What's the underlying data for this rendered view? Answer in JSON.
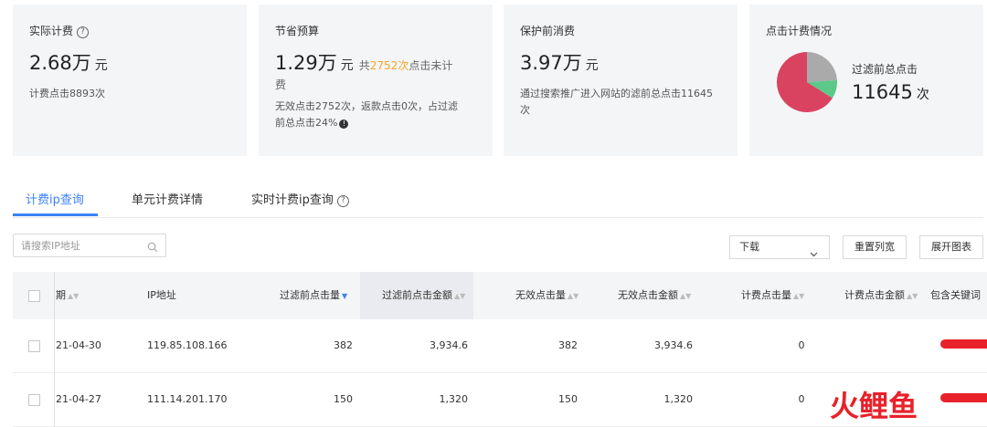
{
  "cards": {
    "actual": {
      "title": "实际计费",
      "value": "2.68万",
      "unit": "元",
      "sub": "计费点击8893次"
    },
    "saved": {
      "title": "节省预算",
      "value": "1.29万",
      "unit": "元",
      "tail_pre": "共",
      "tail_count": "2752次",
      "tail_post": "点击未计",
      "tail_wrap": "费",
      "sub_line1": "无效点击2752次，返款点击0次，占过滤",
      "sub_line2": "前总点击24%"
    },
    "protect": {
      "title": "保护前消费",
      "value": "3.97万",
      "unit": "元",
      "sub_line1": "通过搜索推广进入网站的滤前总点击11645",
      "sub_line2": "次"
    },
    "clicks": {
      "title": "点击计费情况",
      "label": "过滤前总点击",
      "value": "11645",
      "unit": "次"
    }
  },
  "pie": {
    "slices": [
      {
        "share": 0.24,
        "color": "#aaaaaa"
      },
      {
        "share": 0.1,
        "color": "#5cc98a"
      },
      {
        "share": 0.66,
        "color": "#d9435f"
      }
    ]
  },
  "tabs": [
    {
      "label": "计费ip查询",
      "active": true
    },
    {
      "label": "单元计费详情",
      "active": false
    },
    {
      "label": "实时计费ip查询",
      "active": false
    }
  ],
  "toolbar": {
    "search_placeholder": "请搜索IP地址",
    "download_label": "下载",
    "reset_label": "重置列宽",
    "chart_label": "展开图表"
  },
  "table": {
    "headers": [
      "期",
      "IP地址",
      "过滤前点击量",
      "过滤前点击金额",
      "无效点击量",
      "无效点击金额",
      "计费点击量",
      "计费点击金额",
      "包含关键词"
    ],
    "rows": [
      [
        "21-04-30",
        "119.85.108.166",
        "382",
        "3,934.6",
        "382",
        "3,934.6",
        "0"
      ],
      [
        "21-04-27",
        "111.14.201.170",
        "150",
        "1,320",
        "150",
        "1,320",
        "0"
      ]
    ]
  },
  "colors": {
    "accent": "#3b82f6",
    "orange": "#f5a623",
    "redact": "#e8212a",
    "logo": "#e8212a"
  },
  "watermark": {
    "text": "火鲤鱼"
  }
}
